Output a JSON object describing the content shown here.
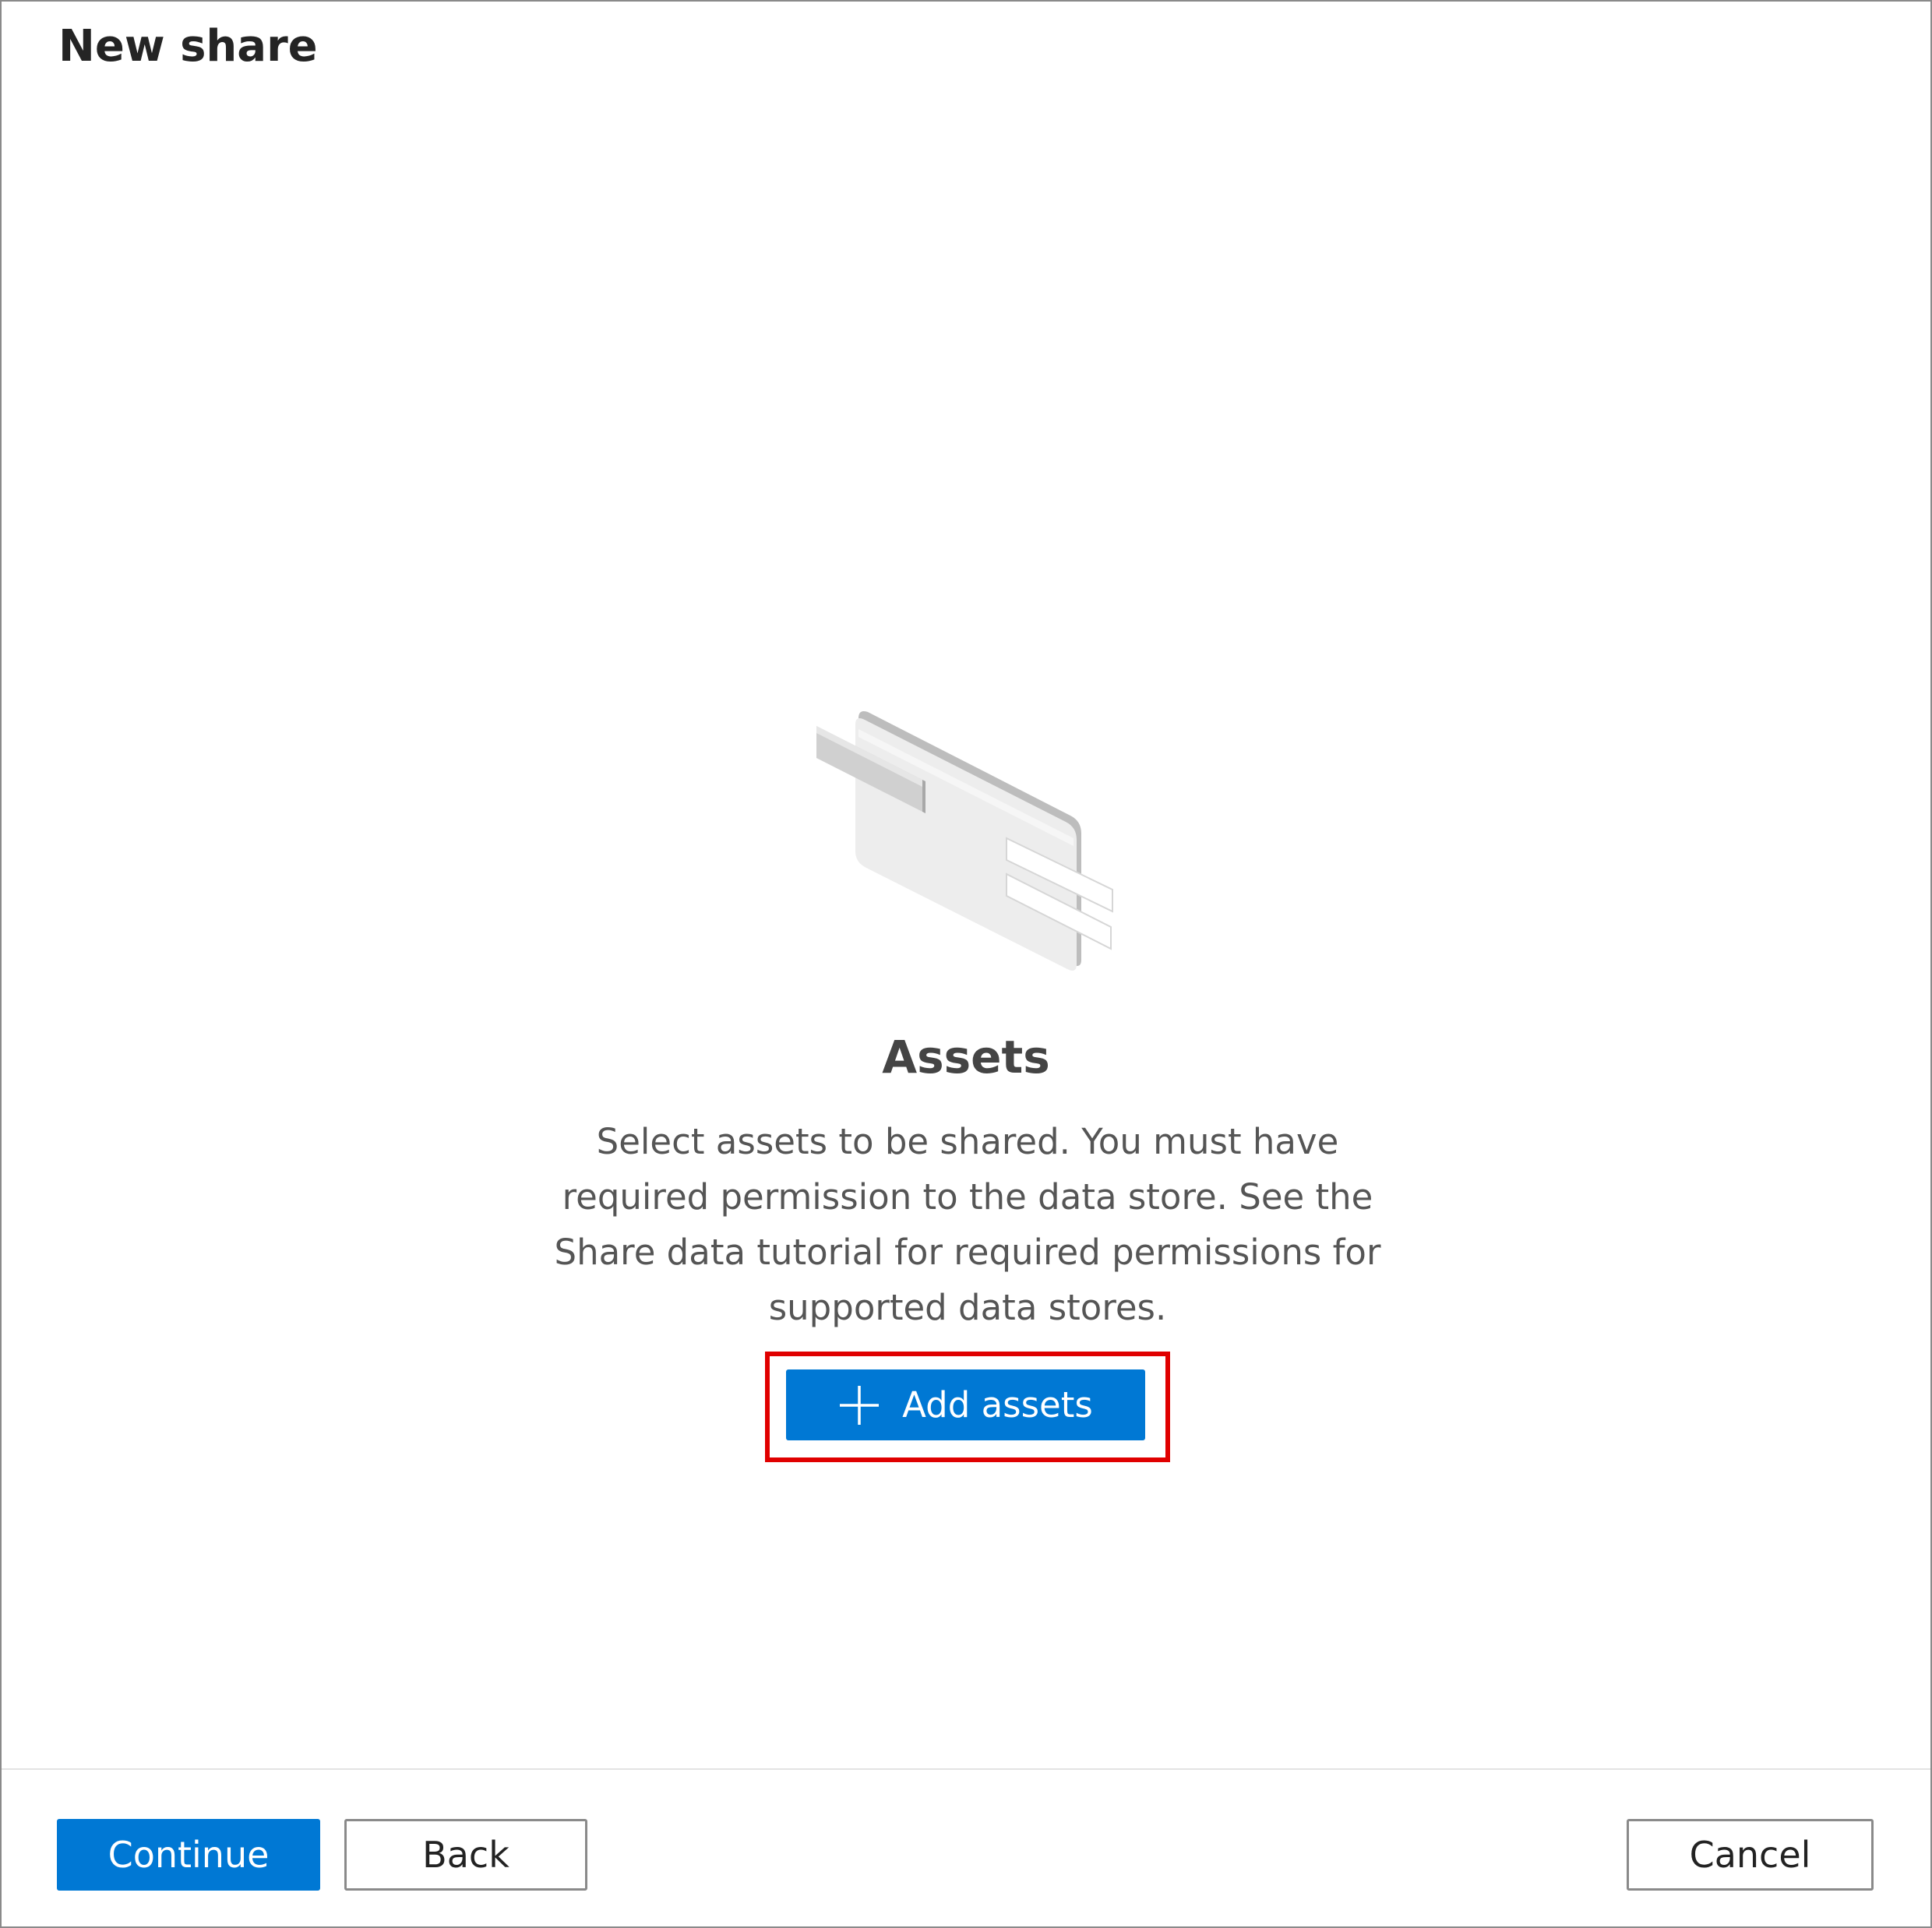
{
  "dialog": {
    "title": "New share"
  },
  "empty_state": {
    "illustration_icon": "assets-card-illustration",
    "heading": "Assets",
    "description": "Select assets to be shared. You must have required permission to the data store. See the Share data tutorial for required permissions for supported data stores.",
    "add_button": {
      "icon": "plus-icon",
      "label": "Add assets"
    },
    "highlight_color": "#e00000"
  },
  "footer": {
    "continue_label": "Continue",
    "back_label": "Back",
    "cancel_label": "Cancel"
  },
  "colors": {
    "accent": "#0078d4"
  }
}
